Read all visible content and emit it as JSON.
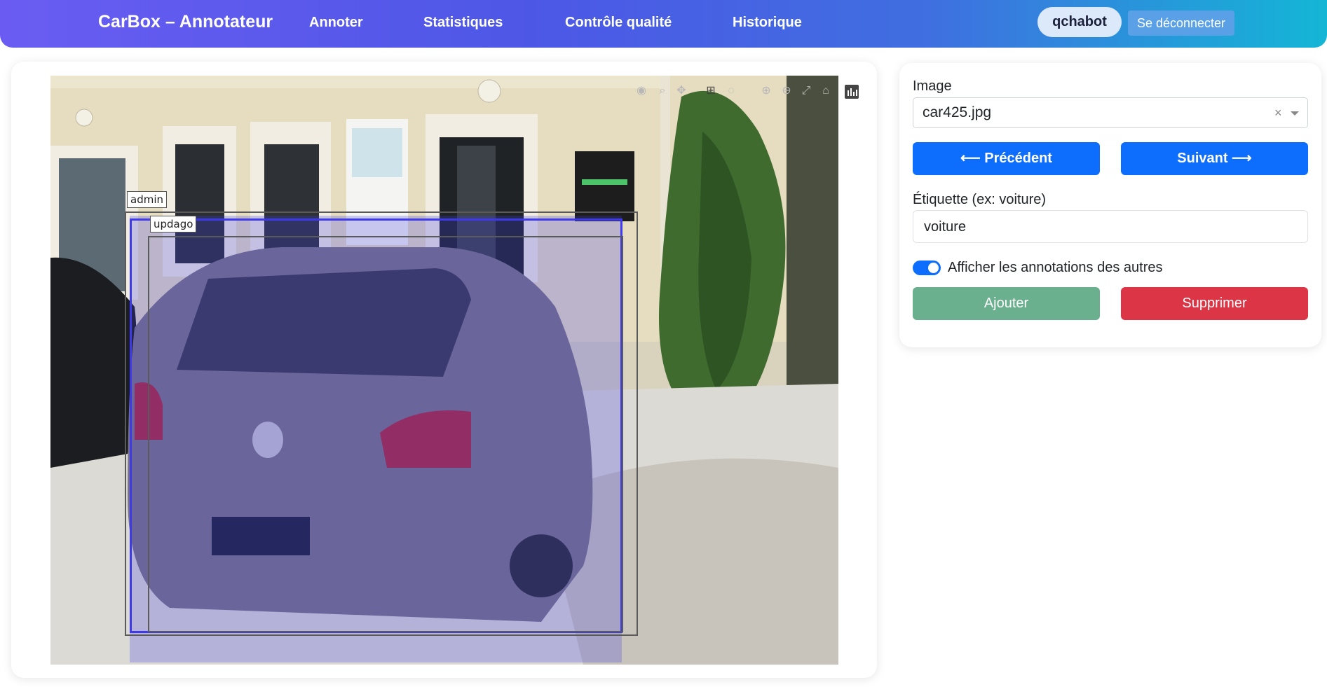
{
  "navbar": {
    "brand": "CarBox – Annotateur",
    "links": [
      "Annoter",
      "Statistiques",
      "Contrôle qualité",
      "Historique"
    ],
    "user": "qchabot",
    "logout": "Se déconnecter",
    "gradient_colors": [
      "#6a5cf2",
      "#4d57e6",
      "#14b6d6"
    ]
  },
  "viewer": {
    "annotations": [
      {
        "label": "admin",
        "color": "#5a5a5a"
      },
      {
        "label": "updago",
        "color": "#3d3ae6"
      }
    ],
    "modebar_icons": [
      "camera-icon",
      "zoom-icon",
      "pan-icon",
      "box-select-icon",
      "lasso-icon",
      "zoom-in-icon",
      "zoom-out-icon",
      "autoscale-icon",
      "home-icon",
      "plotly-logo-icon"
    ]
  },
  "panel": {
    "image_label": "Image",
    "image_value": "car425.jpg",
    "clear_symbol": "×",
    "prev_label": "⟵ Précédent",
    "next_label": "Suivant ⟶",
    "tag_label": "Étiquette (ex: voiture)",
    "tag_value": "voiture",
    "toggle_label": "Afficher les annotations des autres",
    "toggle_on": true,
    "add_label": "Ajouter",
    "delete_label": "Supprimer",
    "colors": {
      "primary": "#0d6efd",
      "success": "#6bb08e",
      "danger": "#dc3545"
    }
  }
}
